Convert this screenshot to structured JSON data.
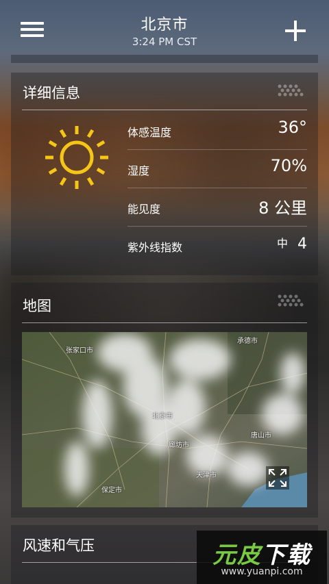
{
  "header": {
    "city": "北京市",
    "time": "3:24 PM CST"
  },
  "details_card": {
    "title": "详细信息",
    "condition_icon": "sun-icon",
    "rows": [
      {
        "label": "体感温度",
        "value": "36°"
      },
      {
        "label": "湿度",
        "value": "70%"
      },
      {
        "label": "能见度",
        "value": "8 公里"
      },
      {
        "label": "紫外线指数",
        "level": "中",
        "value": "4"
      }
    ]
  },
  "map_card": {
    "title": "地图",
    "places": [
      "张家口市",
      "承德市",
      "北京市",
      "唐山市",
      "廊坊市",
      "天津市",
      "保定市"
    ]
  },
  "wind_card": {
    "title": "风速和气压"
  },
  "watermark": {
    "logo_green": "元皮",
    "logo_white": "下载",
    "url": "www.yuanpi.com"
  },
  "colors": {
    "sun": "#f5c518",
    "watermark_green": "#7ac943"
  }
}
